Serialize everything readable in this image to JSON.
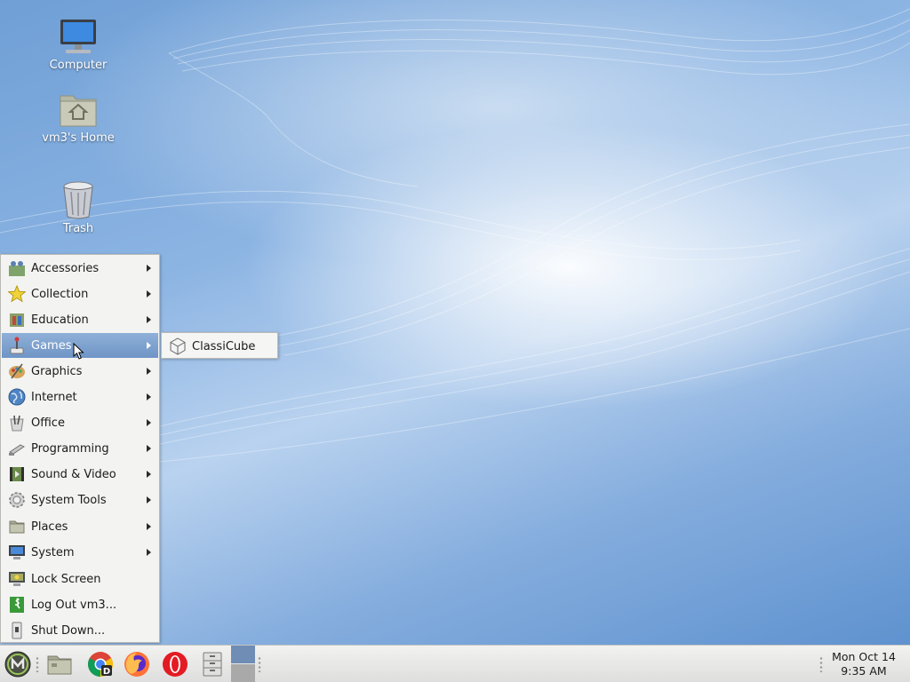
{
  "desktop": {
    "icons": [
      {
        "label": "Computer",
        "icon": "computer-icon"
      },
      {
        "label": "vm3's Home",
        "icon": "home-folder-icon"
      },
      {
        "label": "Trash",
        "icon": "trash-icon"
      }
    ]
  },
  "menu": {
    "items": [
      {
        "label": "Accessories",
        "icon": "accessories-icon",
        "submenu": true
      },
      {
        "label": "Collection",
        "icon": "star-icon",
        "submenu": true
      },
      {
        "label": "Education",
        "icon": "education-icon",
        "submenu": true
      },
      {
        "label": "Games",
        "icon": "games-icon",
        "submenu": true,
        "active": true
      },
      {
        "label": "Graphics",
        "icon": "graphics-icon",
        "submenu": true
      },
      {
        "label": "Internet",
        "icon": "globe-icon",
        "submenu": true
      },
      {
        "label": "Office",
        "icon": "office-icon",
        "submenu": true
      },
      {
        "label": "Programming",
        "icon": "programming-icon",
        "submenu": true
      },
      {
        "label": "Sound & Video",
        "icon": "sound-video-icon",
        "submenu": true
      },
      {
        "label": "System Tools",
        "icon": "system-tools-icon",
        "submenu": true
      },
      {
        "label": "Places",
        "icon": "folder-icon",
        "submenu": true
      },
      {
        "label": "System",
        "icon": "monitor-icon",
        "submenu": true
      },
      {
        "label": "Lock Screen",
        "icon": "lock-screen-icon",
        "submenu": false
      },
      {
        "label": "Log Out vm3...",
        "icon": "logout-icon",
        "submenu": false
      },
      {
        "label": "Shut Down...",
        "icon": "shutdown-icon",
        "submenu": false
      }
    ]
  },
  "submenu": {
    "items": [
      {
        "label": "ClassiCube",
        "icon": "classicube-icon"
      }
    ]
  },
  "taskbar": {
    "launchers": [
      {
        "icon": "mate-menu-icon"
      },
      {
        "icon": "file-manager-icon"
      },
      {
        "icon": "chrome-icon"
      },
      {
        "icon": "firefox-icon"
      },
      {
        "icon": "opera-icon"
      },
      {
        "icon": "file-cabinet-icon"
      }
    ],
    "clock": {
      "date": "Mon Oct 14",
      "time": "9:35 AM"
    }
  },
  "colors": {
    "menu_highlight": "#7a9ecd",
    "menu_bg": "#f3f3f1",
    "taskbar_bg": "#e8e8e6",
    "wallpaper_blue": "#7fa9dc"
  }
}
